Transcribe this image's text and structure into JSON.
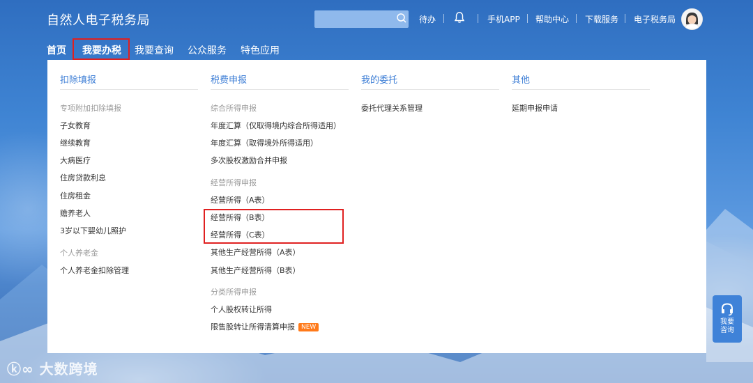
{
  "header": {
    "site_title": "自然人电子税务局",
    "search_placeholder": "",
    "links": {
      "todo": "待办",
      "mobile_app": "手机APP",
      "help_center": "帮助中心",
      "download": "下载服务",
      "e_tax_bureau": "电子税务局"
    },
    "icons": [
      "search-icon",
      "bell-icon",
      "avatar"
    ]
  },
  "nav": {
    "items": [
      "首页",
      "我要办税",
      "我要查询",
      "公众服务",
      "特色应用"
    ]
  },
  "menu": {
    "columns": [
      {
        "title": "扣除填报",
        "items": [
          {
            "label": "专项附加扣除填报",
            "group": true
          },
          {
            "label": "子女教育"
          },
          {
            "label": "继续教育"
          },
          {
            "label": "大病医疗"
          },
          {
            "label": "住房贷款利息"
          },
          {
            "label": "住房租金"
          },
          {
            "label": "赡养老人"
          },
          {
            "label": "3岁以下婴幼儿照护"
          },
          {
            "label": "个人养老金",
            "group": true
          },
          {
            "label": "个人养老金扣除管理"
          }
        ]
      },
      {
        "title": "税费申报",
        "items": [
          {
            "label": "综合所得申报",
            "group": true
          },
          {
            "label": "年度汇算（仅取得境内综合所得适用）"
          },
          {
            "label": "年度汇算（取得境外所得适用）"
          },
          {
            "label": "多次股权激励合并申报"
          },
          {
            "label": "经营所得申报",
            "group": true
          },
          {
            "label": "经营所得（A表）"
          },
          {
            "label": "经营所得（B表）"
          },
          {
            "label": "经营所得（C表）"
          },
          {
            "label": "其他生产经营所得（A表）"
          },
          {
            "label": "其他生产经营所得（B表）"
          },
          {
            "label": "分类所得申报",
            "group": true
          },
          {
            "label": "个人股权转让所得"
          },
          {
            "label": "限售股转让所得清算申报",
            "badge": "NEW"
          }
        ]
      },
      {
        "title": "我的委托",
        "items": [
          {
            "label": "委托代理关系管理"
          }
        ]
      },
      {
        "title": "其他",
        "items": [
          {
            "label": "延期申报申请"
          }
        ]
      }
    ]
  },
  "consult": {
    "line1": "我要",
    "line2": "咨询"
  },
  "watermark": "大数跨境",
  "colors": {
    "accent": "#3f7fd6",
    "highlight_border": "#e02020",
    "badge": "#ff7a1a"
  }
}
